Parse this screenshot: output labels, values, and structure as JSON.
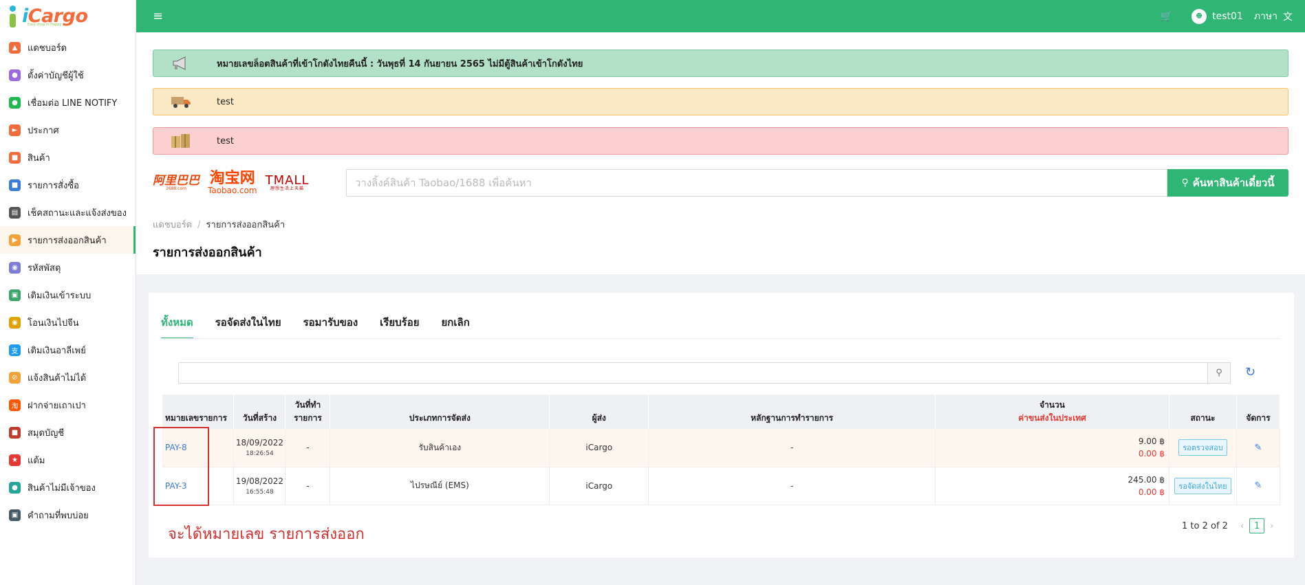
{
  "brand": {
    "logo_text_i": "i",
    "logo_text_rest": "Cargo",
    "logo_sub": "Easy shop in Happy"
  },
  "sidebar": {
    "items": [
      {
        "label": "แดชบอร์ด",
        "icon": "chart-icon",
        "color": "#f36b3b"
      },
      {
        "label": "ตั้งค่าบัญชีผู้ใช้",
        "icon": "user-settings-icon",
        "color": "#9c6ade"
      },
      {
        "label": "เชื่อมต่อ LINE NOTIFY",
        "icon": "line-icon",
        "color": "#1fb94f"
      },
      {
        "label": "ประกาศ",
        "icon": "megaphone-icon",
        "color": "#f36b3b"
      },
      {
        "label": "สินค้า",
        "icon": "product-icon",
        "color": "#f36b3b"
      },
      {
        "label": "รายการสั่งซื้อ",
        "icon": "order-icon",
        "color": "#3a7bd5"
      },
      {
        "label": "เช็คสถานะและแจ้งส่งของ",
        "icon": "checklist-icon",
        "color": "#555555"
      },
      {
        "label": "รายการส่งออกสินค้า",
        "icon": "truck-icon",
        "color": "#f3a13b"
      },
      {
        "label": "รหัสพัสดุ",
        "icon": "parcel-icon",
        "color": "#7d7cd6"
      },
      {
        "label": "เติมเงินเข้าระบบ",
        "icon": "wallet-icon",
        "color": "#3aa66b"
      },
      {
        "label": "โอนเงินไปจีน",
        "icon": "coin-icon",
        "color": "#e0a100"
      },
      {
        "label": "เติมเงินอาลีเพย์",
        "icon": "alipay-icon",
        "color": "#1e9bf0"
      },
      {
        "label": "แจ้งสินค้าไม่ได้",
        "icon": "no-item-icon",
        "color": "#f3a13b"
      },
      {
        "label": "ฝากจ่ายเถาเปา",
        "icon": "taobao-icon",
        "color": "#ff5500"
      },
      {
        "label": "สมุดบัญชี",
        "icon": "account-book-icon",
        "color": "#c0392b"
      },
      {
        "label": "แต้ม",
        "icon": "points-icon",
        "color": "#e53935"
      },
      {
        "label": "สินค้าไม่มีเจ้าของ",
        "icon": "unowned-icon",
        "color": "#26a69a"
      },
      {
        "label": "คำถามที่พบบ่อย",
        "icon": "faq-icon",
        "color": "#455a64"
      }
    ],
    "active_index": 7
  },
  "header": {
    "username": "test01",
    "language": "ภาษา",
    "menu_icon": "hamburger-icon",
    "cart_icon": "cart-icon",
    "translate_icon": "translate-icon"
  },
  "alerts": {
    "green": "หมายเลขล็อตสินค้าที่เข้าโกดังไทยคืนนี้ : วันพุธที่ 14 กันยายน 2565 ไม่มีตู้สินค้าเข้าโกดังไทย",
    "yellow": "test",
    "red": "test"
  },
  "search": {
    "placeholder": "วางลิ้งค์สินค้า Taobao/1688 เพื่อค้นหา",
    "button": "ค้นหาสินค้าเดี๋ยวนี้",
    "brands": {
      "b1688_main": "阿里巴巴",
      "b1688_sub": "1688.com",
      "taobao_main": "淘宝网",
      "taobao_sub": "Taobao.com",
      "tmall_main": "TMALL",
      "tmall_sub": "理想生活上天猫"
    }
  },
  "breadcrumb": {
    "home": "แดชบอร์ด",
    "current": "รายการส่งออกสินค้า"
  },
  "page_title": "รายการส่งออกสินค้า",
  "tabs": [
    "ทั้งหมด",
    "รอจัดส่งในไทย",
    "รอมารับของ",
    "เรียบร้อย",
    "ยกเลิก"
  ],
  "table": {
    "headers": {
      "id": "หมายเลขรายการ",
      "created": "วันที่สร้าง",
      "done_date": "วันที่ทำรายการ",
      "ship_type": "ประเภทการจัดส่ง",
      "sender": "ผู้ส่ง",
      "evidence": "หลักฐานการทำรายการ",
      "amount": "จำนวน",
      "amount_sub": "ค่าขนส่งในประเทศ",
      "status": "สถานะ",
      "action": "จัดการ"
    },
    "rows": [
      {
        "id": "PAY-8",
        "date": "18/09/2022",
        "time": "18:26:54",
        "done_date": "-",
        "ship_type": "รับสินค้าเอง",
        "sender": "iCargo",
        "evidence": "-",
        "amount": "9.00 ฿",
        "domestic": "0.00 ฿",
        "status": "รอตรวจสอบ"
      },
      {
        "id": "PAY-3",
        "date": "19/08/2022",
        "time": "16:55:48",
        "done_date": "-",
        "ship_type": "ไปรษณีย์ (EMS)",
        "sender": "iCargo",
        "evidence": "-",
        "amount": "245.00 ฿",
        "domestic": "0.00 ฿",
        "status": "รอจัดส่งในไทย"
      }
    ]
  },
  "annotation": "จะได้หมายเลข รายการส่งออก",
  "pagination": {
    "summary": "1 to 2 of 2",
    "page": "1"
  }
}
